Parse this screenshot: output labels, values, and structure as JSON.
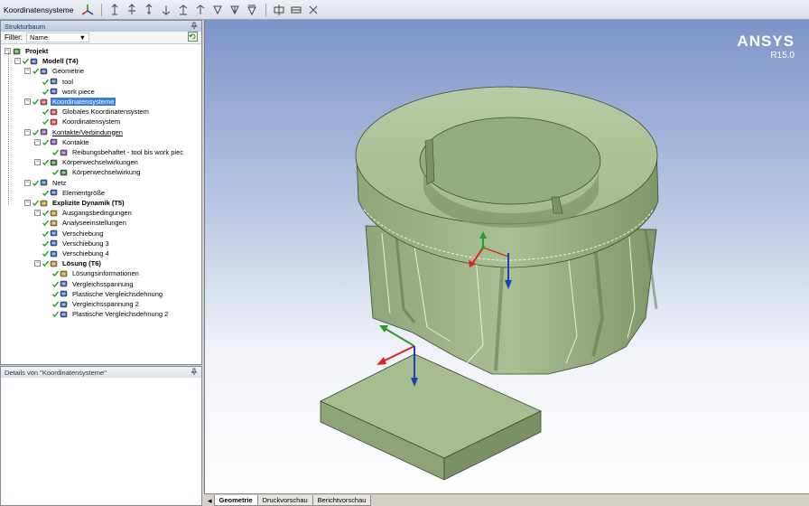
{
  "toolbar": {
    "context_label": "Koordinatensysteme",
    "icons": [
      "coordinate-system-icon",
      "align-x-icon",
      "align-y-icon",
      "align-z-icon",
      "rotate-x-icon",
      "rotate-y-icon",
      "rotate-z-icon",
      "flip-x-icon",
      "flip-y-icon",
      "flip-z-icon",
      "move-icon",
      "reset-icon",
      "clear-icon"
    ]
  },
  "tree_panel": {
    "title": "Strukturbaum",
    "filter_label": "Filter:",
    "filter_value": "Name",
    "items": [
      {
        "label": "Projekt",
        "bold": true
      },
      {
        "label": "Modell (T4)",
        "bold": true
      },
      {
        "label": "Geometrie"
      },
      {
        "label": "tool"
      },
      {
        "label": "work piece"
      },
      {
        "label": "Koordinatensysteme",
        "selected": true
      },
      {
        "label": "Globales Koordinatensystem"
      },
      {
        "label": "Koordinatensystem"
      },
      {
        "label": "Kontakte/Verbindungen",
        "underline": true
      },
      {
        "label": "Kontakte"
      },
      {
        "label": "Reibungsbehaftet - tool bis work piec"
      },
      {
        "label": "Körperwechselwirkungen"
      },
      {
        "label": "Körperwechselwirkung"
      },
      {
        "label": "Netz"
      },
      {
        "label": "Elementgröße"
      },
      {
        "label": "Explizite Dynamik (T5)",
        "bold": true
      },
      {
        "label": "Ausgangsbedingungen"
      },
      {
        "label": "Analyseeinstellungen"
      },
      {
        "label": "Verschiebung"
      },
      {
        "label": "Verschiebung 3"
      },
      {
        "label": "Verschiebung 4"
      },
      {
        "label": "Lösung (T6)",
        "bold": true
      },
      {
        "label": "Lösungsinformationen"
      },
      {
        "label": "Vergleichsspannung"
      },
      {
        "label": "Plastische Vergleichsdehnung"
      },
      {
        "label": "Vergleichsspannung 2"
      },
      {
        "label": "Plastische Vergleichsdehnung 2"
      }
    ]
  },
  "details_panel": {
    "title": "Details von \"Koordinatensysteme\""
  },
  "viewport": {
    "brand": "ANSYS",
    "version": "R15.0",
    "model_color": "#a9bf94"
  },
  "tabs": [
    {
      "label": "Geometrie",
      "active": true
    },
    {
      "label": "Druckvorschau"
    },
    {
      "label": "Berichtvorschau"
    }
  ]
}
